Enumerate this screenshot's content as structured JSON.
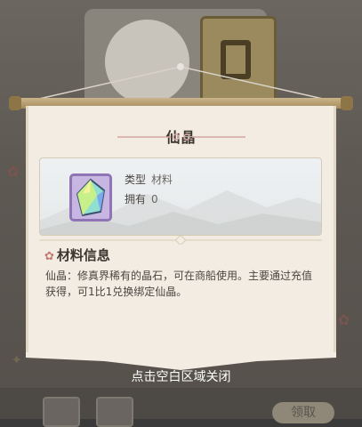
{
  "dialog": {
    "title": "仙晶",
    "item": {
      "icon": "crystal-icon",
      "type_label": "类型",
      "type_value": "材料",
      "owned_label": "拥有",
      "owned_value": "0"
    },
    "info_heading": "材料信息",
    "info_icon": "blossom-icon",
    "description": "仙晶：修真界稀有的晶石，可在商船使用。主要通过充值获得，可1比1兑换绑定仙晶。"
  },
  "close_hint": "点击空白区域关闭",
  "background": {
    "claim_button_label": "领取"
  },
  "colors": {
    "panel": "#f2ece2",
    "accent_red": "#c47a73",
    "icon_purple": "#c7b6e2"
  }
}
